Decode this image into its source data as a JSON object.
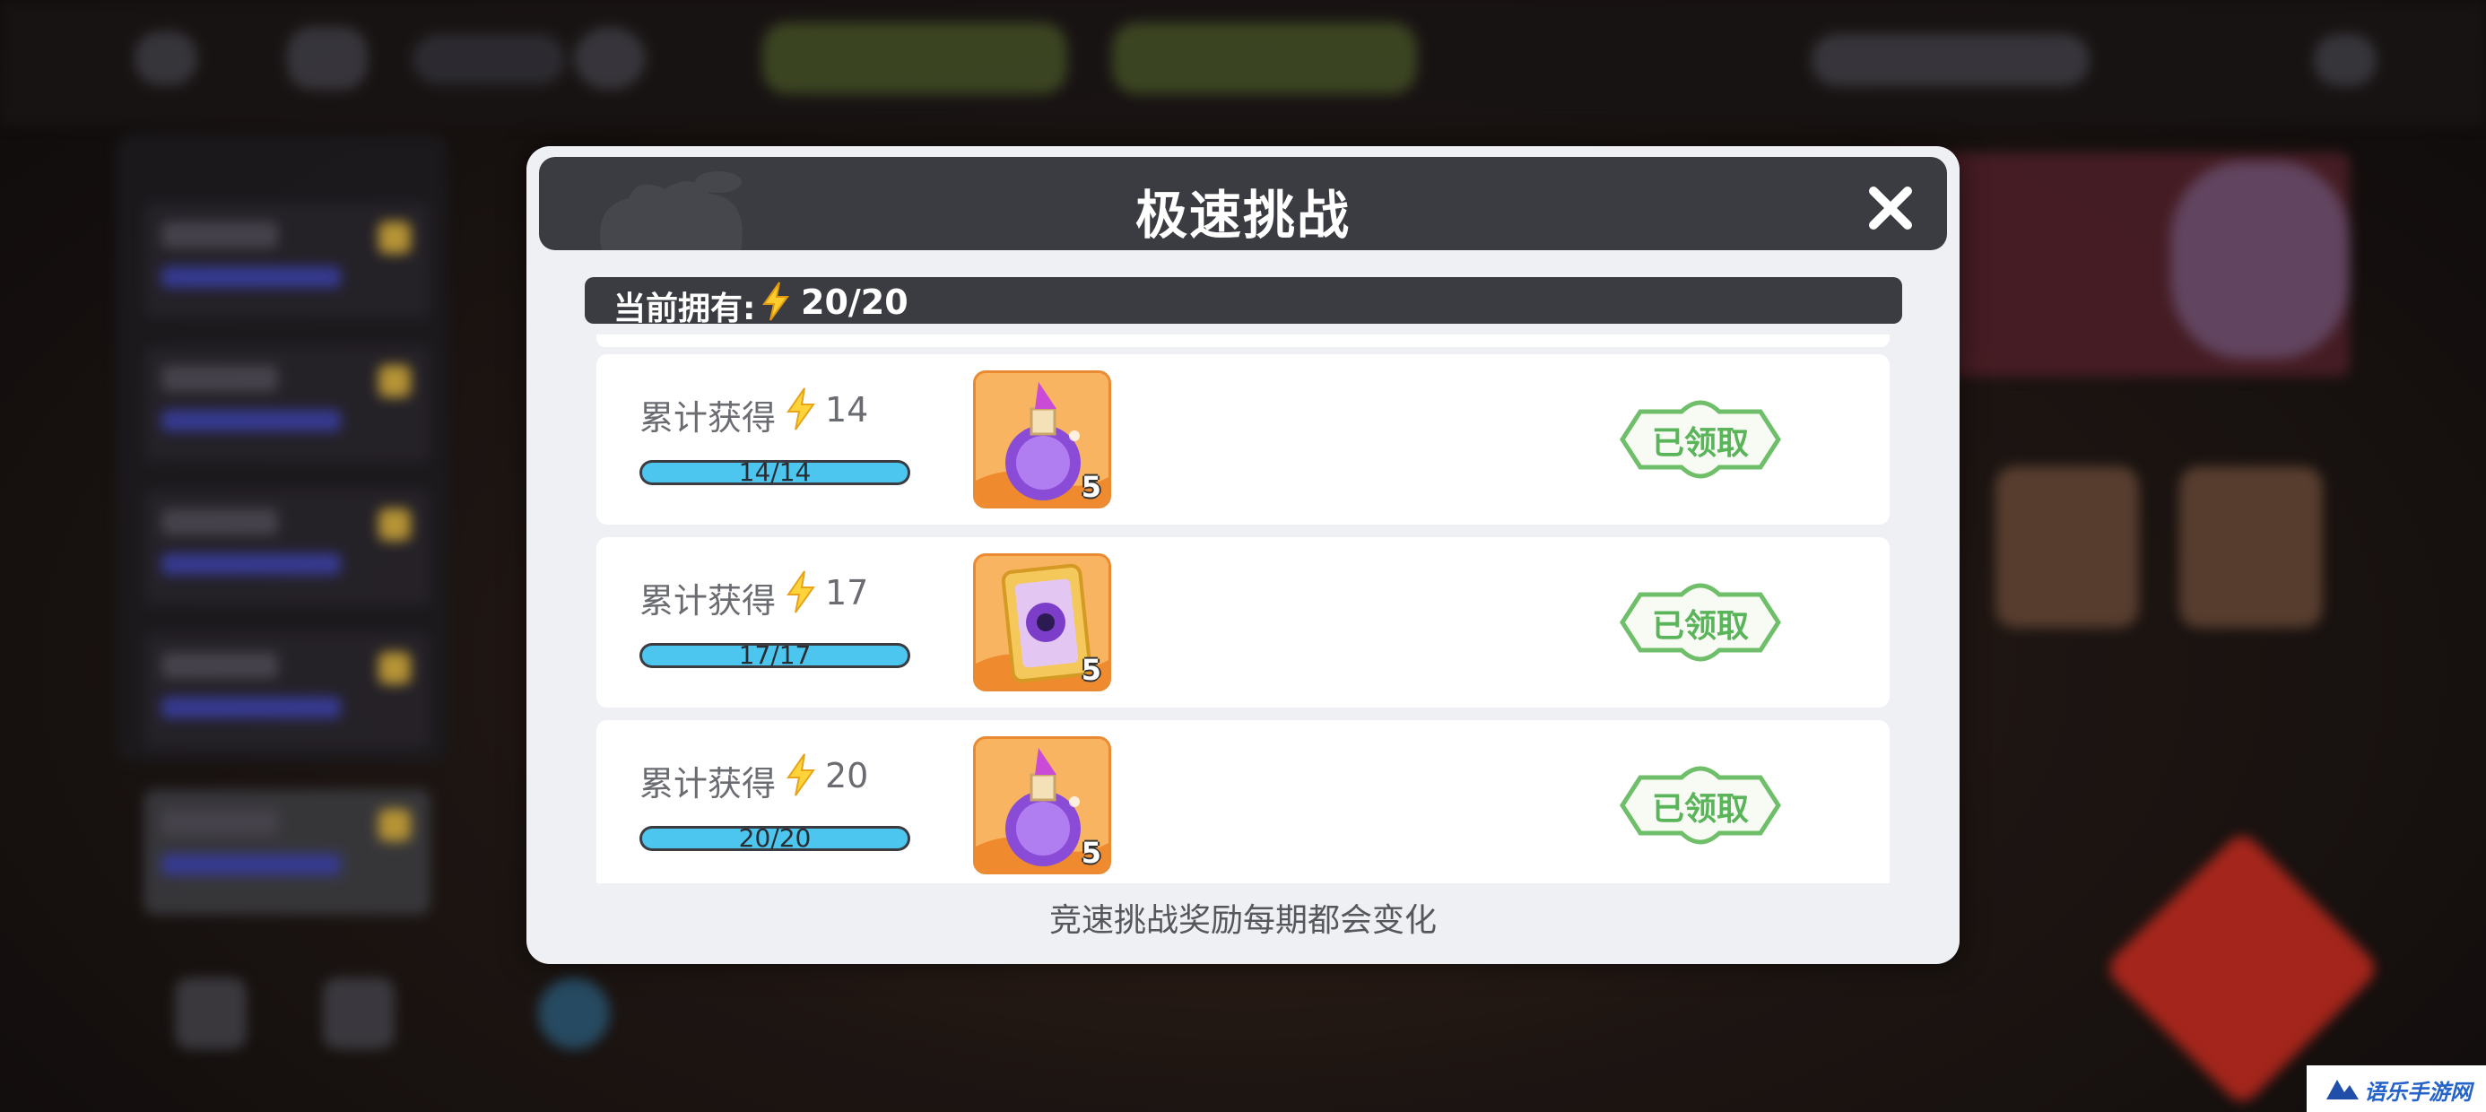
{
  "dialog": {
    "title": "极速挑战",
    "balance_label": "当前拥有:",
    "balance_value": "20/20",
    "footer_note": "竞速挑战奖励每期都会变化"
  },
  "rewards": [
    {
      "label": "累计获得",
      "target": "14",
      "progress_text": "14/14",
      "progress": 1.0,
      "item_icon": "potion-bottle-icon",
      "item_count": "5",
      "status": "已领取"
    },
    {
      "label": "累计获得",
      "target": "17",
      "progress_text": "17/17",
      "progress": 1.0,
      "item_icon": "gem-card-icon",
      "item_count": "5",
      "status": "已领取"
    },
    {
      "label": "累计获得",
      "target": "20",
      "progress_text": "20/20",
      "progress": 1.0,
      "item_icon": "potion-bottle-icon",
      "item_count": "5",
      "status": "已领取"
    }
  ],
  "icons": {
    "close": "close-icon",
    "energy": "lightning-bolt-icon"
  },
  "colors": {
    "header_bg": "#3a3c42",
    "progress_fill": "#4cc6ef",
    "claimed_green": "#5ab55a",
    "item_frame": "#f5a04a"
  },
  "watermark": {
    "text": "语乐手游网"
  }
}
